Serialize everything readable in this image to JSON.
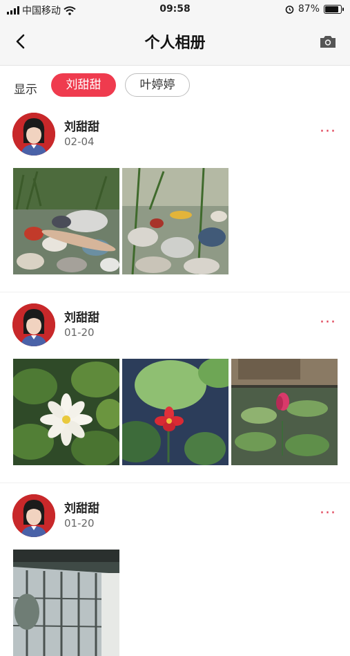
{
  "status": {
    "carrier": "中国移动",
    "time": "09:58",
    "battery": "87%",
    "battery_level": 0.87
  },
  "header": {
    "title": "个人相册"
  },
  "filter": {
    "label": "显示",
    "chips": [
      "刘甜甜",
      "叶婷婷"
    ]
  },
  "posts": [
    {
      "name": "刘甜甜",
      "date": "02-04"
    },
    {
      "name": "刘甜甜",
      "date": "01-20"
    },
    {
      "name": "刘甜甜",
      "date": "01-20"
    }
  ],
  "colors": {
    "accent": "#ef3b4e",
    "more": "#e0455a"
  }
}
